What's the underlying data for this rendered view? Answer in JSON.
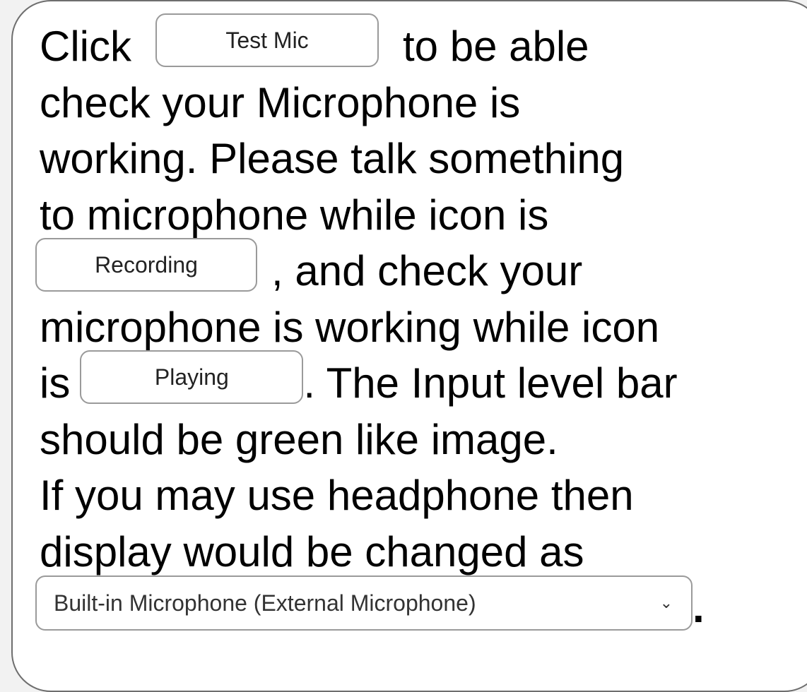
{
  "instructions": {
    "l1_a": "Click",
    "test_mic_label": "Test Mic",
    "l1_b": "to be able",
    "l2": "check your Microphone is",
    "l3": "working. Please talk something",
    "l4": "to microphone while icon is",
    "recording_label": "Recording",
    "l5_b": ", and check your",
    "l6": "microphone is working while icon",
    "l7_a": "is",
    "playing_label": "Playing",
    "l7_b": ". The Input level bar",
    "l8": "should be green like image.",
    "l9": "If you may use headphone then",
    "l10": "display would be changed as",
    "mic_select_value": "Built-in Microphone (External Microphone)",
    "l11_end": "."
  },
  "icons": {
    "select_chevron": "chevron-down-icon"
  }
}
